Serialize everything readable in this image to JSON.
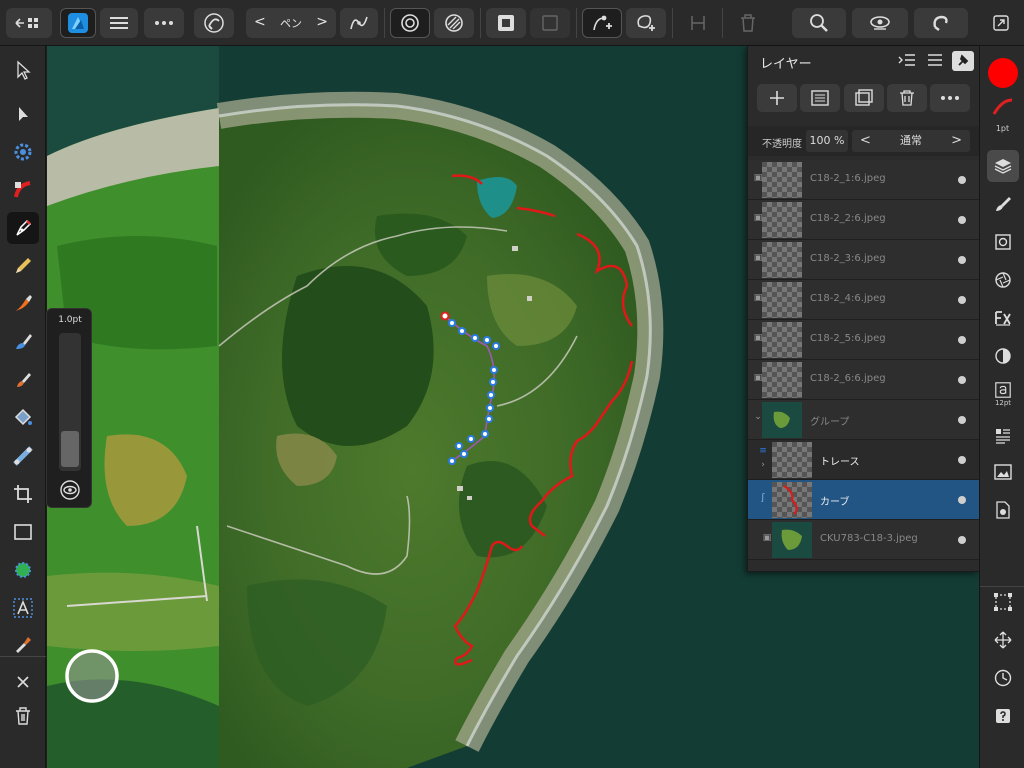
{
  "toolbar": {
    "pen_mode_label": "ペン",
    "prev_arrow": "<",
    "next_arrow": ">"
  },
  "brush_size_popup": {
    "label": "1.0pt"
  },
  "layers_panel": {
    "title": "レイヤー",
    "opacity_label": "不透明度",
    "opacity_value": "100 %",
    "blend_mode": "通常",
    "blend_prev": "<",
    "blend_next": ">",
    "layers": [
      {
        "name": "C18-2_1:6.jpeg",
        "type": "image"
      },
      {
        "name": "C18-2_2:6.jpeg",
        "type": "image"
      },
      {
        "name": "C18-2_3:6.jpeg",
        "type": "image"
      },
      {
        "name": "C18-2_4:6.jpeg",
        "type": "image"
      },
      {
        "name": "C18-2_5:6.jpeg",
        "type": "image"
      },
      {
        "name": "C18-2_6:6.jpeg",
        "type": "image"
      },
      {
        "name": "グループ",
        "type": "group"
      },
      {
        "name": "トレース",
        "type": "vector"
      },
      {
        "name": "カーブ",
        "type": "curve",
        "selected": true
      },
      {
        "name": "CKU783-C18-3.jpeg",
        "type": "image"
      }
    ]
  },
  "color": {
    "primary": "#ff0000",
    "stroke_width_label": "1pt",
    "accent_blue": "#225584"
  },
  "right_strip": {
    "character_size_label": "12pt"
  },
  "icons": [
    "back-icon",
    "affinity-logo-icon",
    "menu-icon",
    "more-icon",
    "snapping-icon",
    "pen-icon",
    "spiro-icon",
    "target-icon",
    "hatch-icon",
    "mask-icon",
    "square-icon",
    "node-add-icon",
    "shape-add-icon",
    "align-icon",
    "trash-icon",
    "zoom-icon",
    "view-icon",
    "magnet-icon",
    "export-icon"
  ]
}
